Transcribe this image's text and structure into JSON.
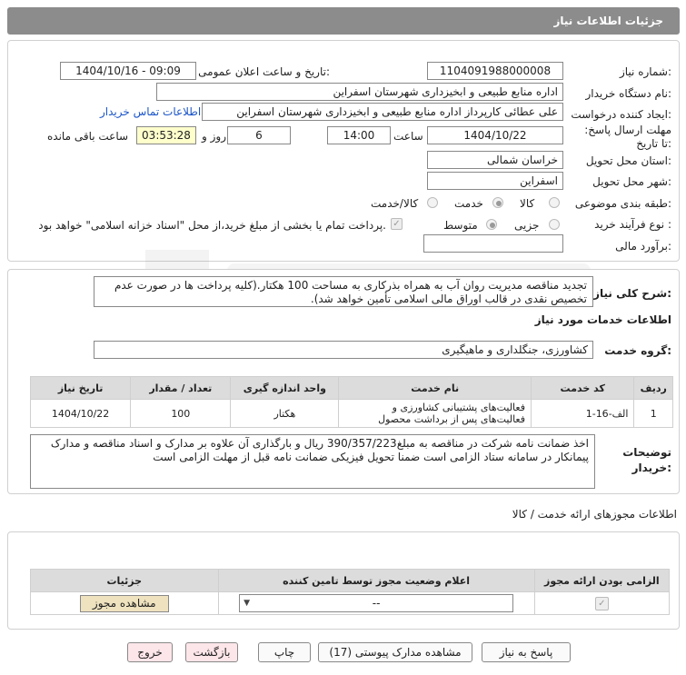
{
  "header": {
    "title": "جزئیات اطلاعات نیاز"
  },
  "fields": {
    "need_number_label": "شماره نیاز:",
    "need_number": "1104091988000008",
    "announce_label": "تاریخ و ساعت اعلان عمومی:",
    "announce_value": "1404/10/16 - 09:09",
    "buyer_org_label": "نام دستگاه خریدار:",
    "buyer_org": "اداره منابع طبیعی و ابخیزداری شهرستان اسفراین",
    "creator_label": "ایجاد کننده درخواست:",
    "creator": "علی  عطائی  کارپرداز اداره منابع طبیعی و ابخیزداری شهرستان اسفراین",
    "contact_link": "اطلاعات تماس خریدار",
    "deadline_label": "مهلت ارسال پاسخ: تا تاریخ:",
    "deadline_date": "1404/10/22",
    "time_label": "ساعت",
    "deadline_time": "14:00",
    "days_value": "6",
    "days_label": "روز و",
    "remaining_time": "03:53:28",
    "remaining_label": "ساعت باقی مانده",
    "province_label": "استان محل تحویل:",
    "province": "خراسان شمالی",
    "city_label": "شهر محل تحویل:",
    "city": "اسفراین",
    "category_label": "طبقه بندی موضوعی:",
    "category_options": [
      "کالا",
      "خدمت",
      "کالا/خدمت"
    ],
    "process_label": "نوع فرآیند خرید :",
    "process_options": [
      "جزیی",
      "متوسط"
    ],
    "payment_note": "پرداخت تمام یا بخشی از مبلغ خرید،از محل \"اسناد خزانه اسلامی\" خواهد بود.",
    "budget_label": "برآورد مالی:",
    "budget_value": ""
  },
  "description": {
    "label": "شرح کلی نیاز:",
    "text": "تجدید مناقصه مدیریت روان آب به همراه بذرکاری به مساحت 100  هکتار.(کلیه پرداخت ها در صورت عدم تخصیص نقدی در قالب اوراق مالی اسلامی تأمین خواهد شد)."
  },
  "services": {
    "section_title": "اطلاعات خدمات مورد نیاز",
    "group_label": "گروه خدمت:",
    "group_value": "کشاورزی، جنگلداری و ماهیگیری",
    "columns": [
      "ردیف",
      "کد خدمت",
      "نام خدمت",
      "واحد اندازه گیری",
      "تعداد / مقدار",
      "تاریخ نیاز"
    ],
    "rows": [
      {
        "row": "1",
        "code": "الف-16-1",
        "name": "فعالیت‌های پشتیبانی کشاورزی و فعالیت‌های پس از برداشت محصول",
        "unit": "هکتار",
        "qty": "100",
        "date": "1404/10/22"
      }
    ]
  },
  "buyer_notes": {
    "label": "توضیحات خریدار:",
    "text": "اخذ ضمانت نامه شرکت در مناقصه به مبلغ390/357/223 ریال  و بارگذاری آن علاوه بر مدارک و اسناد مناقصه و مدارک پیمانکار در سامانه ستاد الزامی است ضمنا تحویل فیزیکی ضمانت نامه قبل از مهلت الزامی است"
  },
  "permits": {
    "section_title": "اطلاعات مجوزهای ارائه خدمت / کالا",
    "columns": [
      "الزامی بودن ارائه مجوز",
      "اعلام وضعیت مجوز توسط تامین کننده",
      "جزئیات"
    ],
    "select_value": "--",
    "view_button": "مشاهده مجوز"
  },
  "buttons": {
    "reply": "پاسخ به نیاز",
    "attachments": "مشاهده مدارک پیوستی (17)",
    "print": "چاپ",
    "back": "بازگشت",
    "exit": "خروج"
  }
}
